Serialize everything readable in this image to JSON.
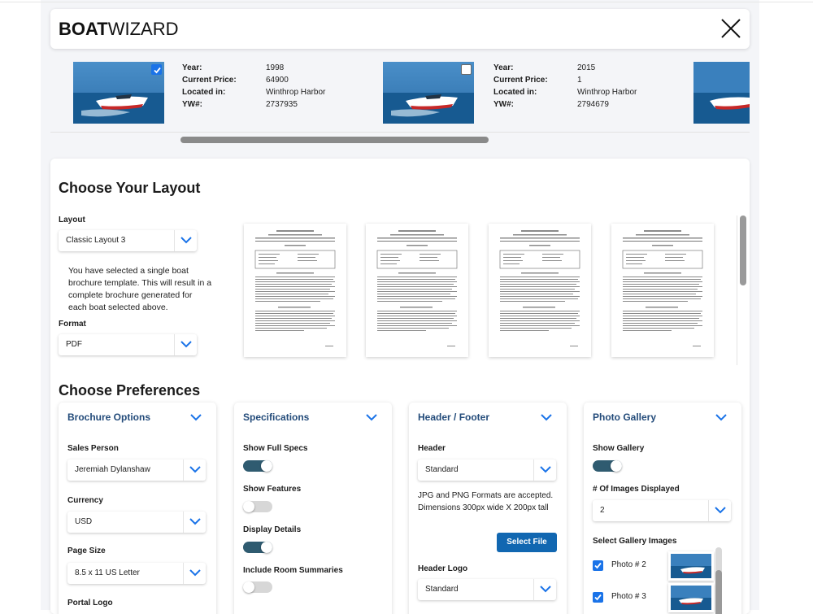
{
  "app": {
    "logo_bold": "BOAT",
    "logo_light": "WIZARD"
  },
  "boats": [
    {
      "year_label": "Year:",
      "year": "1998",
      "price_label": "Current Price:",
      "price": "64900",
      "location_label": "Located in:",
      "location": "Winthrop Harbor",
      "yw_label": "YW#:",
      "yw": "2737935",
      "selected": true
    },
    {
      "year_label": "Year:",
      "year": "2015",
      "price_label": "Current Price:",
      "price": "1",
      "location_label": "Located in:",
      "location": "Winthrop Harbor",
      "yw_label": "YW#:",
      "yw": "2794679",
      "selected": false
    }
  ],
  "layout_section": {
    "title": "Choose Your Layout",
    "layout_label": "Layout",
    "layout_value": "Classic Layout 3",
    "description": "You have selected a single boat brochure template. This will result in a complete brochure generated for each boat selected above.",
    "format_label": "Format",
    "format_value": "PDF"
  },
  "preferences": {
    "title": "Choose Preferences",
    "brochure_options": {
      "title": "Brochure Options",
      "sales_person_label": "Sales Person",
      "sales_person_value": "Jeremiah Dylanshaw",
      "currency_label": "Currency",
      "currency_value": "USD",
      "page_size_label": "Page Size",
      "page_size_value": "8.5 x 11 US Letter",
      "portal_logo_label": "Portal Logo"
    },
    "specifications": {
      "title": "Specifications",
      "show_full_specs_label": "Show Full Specs",
      "show_full_specs": true,
      "show_features_label": "Show Features",
      "show_features": false,
      "display_details_label": "Display Details",
      "display_details": true,
      "include_room_summaries_label": "Include Room Summaries",
      "include_room_summaries": false
    },
    "header_footer": {
      "title": "Header / Footer",
      "header_label": "Header",
      "header_value": "Standard",
      "note": "JPG and PNG Formats are accepted. Dimensions 300px wide X 200px tall",
      "select_file_label": "Select File",
      "header_logo_label": "Header Logo",
      "header_logo_value": "Standard"
    },
    "photo_gallery": {
      "title": "Photo Gallery",
      "show_gallery_label": "Show Gallery",
      "show_gallery": true,
      "images_displayed_label": "# Of Images Displayed",
      "images_displayed_value": "2",
      "select_images_label": "Select Gallery Images",
      "images": [
        {
          "label": "Photo # 2",
          "checked": true
        },
        {
          "label": "Photo # 3",
          "checked": true
        }
      ]
    }
  },
  "colors": {
    "accent": "#1a73e8",
    "card_title": "#234b7a",
    "toggle_on": "#2f5b70",
    "button": "#1167b1"
  },
  "icons": {
    "close": "close-icon",
    "chevron": "chevron-down-icon",
    "check": "checkbox-icon"
  }
}
